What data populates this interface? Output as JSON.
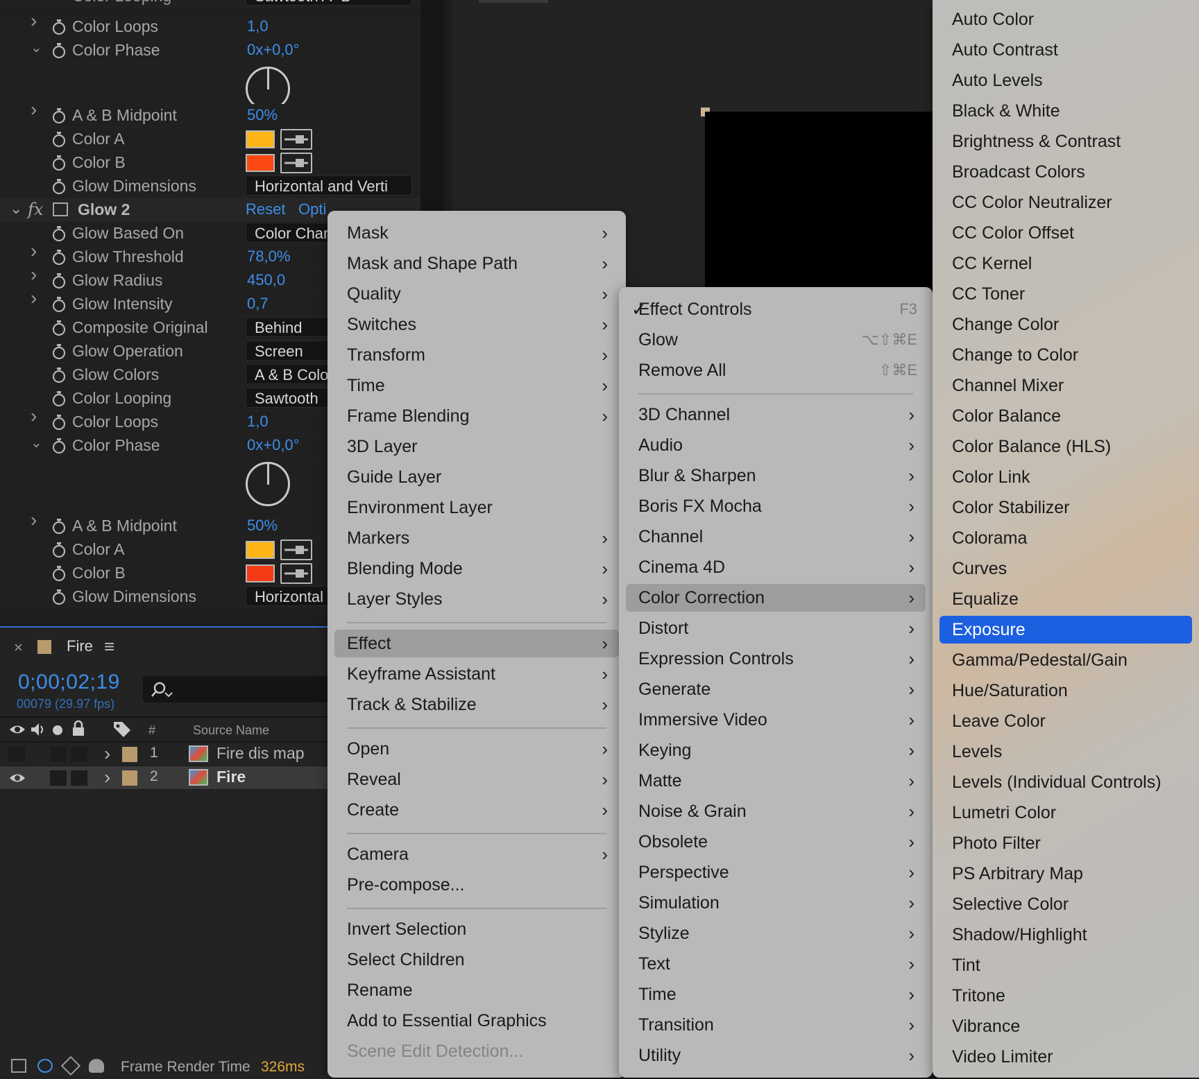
{
  "effect_controls": {
    "top_clip_row": {
      "label": "Color Looping",
      "value": "Sawtooth A>B"
    },
    "rows_a": [
      {
        "type": "num",
        "twirl": "right",
        "label": "Color Loops",
        "value": "1,0"
      },
      {
        "type": "num",
        "twirl": "down",
        "label": "Color Phase",
        "value": "0x+0,0°"
      }
    ],
    "rows_b": [
      {
        "type": "num",
        "twirl": "right",
        "label": "A & B Midpoint",
        "value": "50%"
      },
      {
        "type": "color",
        "label": "Color A",
        "color": "#fdb515"
      },
      {
        "type": "color",
        "label": "Color B",
        "color": "#fb4a12"
      },
      {
        "type": "dd",
        "label": "Glow Dimensions",
        "value": "Horizontal and Verti"
      }
    ],
    "glow2": {
      "name": "Glow 2",
      "reset": "Reset",
      "options": "Opti",
      "fx": "fx"
    },
    "rows_c": [
      {
        "type": "dd",
        "label": "Glow Based On",
        "value": "Color Chan"
      },
      {
        "type": "num",
        "twirl": "right",
        "label": "Glow Threshold",
        "value": "78,0%"
      },
      {
        "type": "num",
        "twirl": "right",
        "label": "Glow Radius",
        "value": "450,0"
      },
      {
        "type": "num",
        "twirl": "right",
        "label": "Glow Intensity",
        "value": "0,7"
      },
      {
        "type": "dd",
        "label": "Composite Original",
        "value": "Behind"
      },
      {
        "type": "dd",
        "label": "Glow Operation",
        "value": "Screen"
      },
      {
        "type": "dd",
        "label": "Glow Colors",
        "value": "A & B Colo"
      },
      {
        "type": "dd",
        "label": "Color Looping",
        "value": "Sawtooth"
      },
      {
        "type": "num",
        "twirl": "right",
        "label": "Color Loops",
        "value": "1,0"
      },
      {
        "type": "num",
        "twirl": "down",
        "label": "Color Phase",
        "value": "0x+0,0°"
      }
    ],
    "rows_d": [
      {
        "type": "num",
        "twirl": "right",
        "label": "A & B Midpoint",
        "value": "50%"
      },
      {
        "type": "color",
        "label": "Color A",
        "color": "#fdb515"
      },
      {
        "type": "color",
        "label": "Color B",
        "color": "#f53a16"
      },
      {
        "type": "dd",
        "label": "Glow Dimensions",
        "value": "Horizontal"
      }
    ]
  },
  "timeline": {
    "close": "×",
    "comp_name": "Fire",
    "menu_icon": "≡",
    "timecode": "0;00;02;19",
    "frames": "00079 (29.97 fps)",
    "col_number": "#",
    "col_source": "Source Name",
    "layers": [
      {
        "num": "1",
        "name": "Fire dis map",
        "visible": false
      },
      {
        "num": "2",
        "name": "Fire",
        "visible": true
      }
    ],
    "footer_label": "Frame Render Time",
    "footer_value": "326ms"
  },
  "menu1": {
    "items": [
      {
        "label": "Mask",
        "sub": true
      },
      {
        "label": "Mask and Shape Path",
        "sub": true
      },
      {
        "label": "Quality",
        "sub": true
      },
      {
        "label": "Switches",
        "sub": true
      },
      {
        "label": "Transform",
        "sub": true
      },
      {
        "label": "Time",
        "sub": true
      },
      {
        "label": "Frame Blending",
        "sub": true
      },
      {
        "label": "3D Layer",
        "sub": false
      },
      {
        "label": "Guide Layer",
        "sub": false
      },
      {
        "label": "Environment Layer",
        "sub": false
      },
      {
        "label": "Markers",
        "sub": true
      },
      {
        "label": "Blending Mode",
        "sub": true
      },
      {
        "label": "Layer Styles",
        "sub": true
      },
      {
        "sep": true
      },
      {
        "label": "Effect",
        "sub": true,
        "selected": true
      },
      {
        "label": "Keyframe Assistant",
        "sub": true
      },
      {
        "label": "Track & Stabilize",
        "sub": true
      },
      {
        "sep": true
      },
      {
        "label": "Open",
        "sub": true
      },
      {
        "label": "Reveal",
        "sub": true
      },
      {
        "label": "Create",
        "sub": true
      },
      {
        "sep": true
      },
      {
        "label": "Camera",
        "sub": true
      },
      {
        "label": "Pre-compose...",
        "sub": false
      },
      {
        "sep": true
      },
      {
        "label": "Invert Selection",
        "sub": false
      },
      {
        "label": "Select Children",
        "sub": false
      },
      {
        "label": "Rename",
        "sub": false
      },
      {
        "label": "Add to Essential Graphics",
        "sub": false
      },
      {
        "label": "Scene Edit Detection...",
        "sub": false,
        "disabled": true
      }
    ]
  },
  "menu2": {
    "items": [
      {
        "label": "Effect Controls",
        "check": "✓",
        "shortcut": "F3"
      },
      {
        "label": "Glow",
        "shortcut": "⌥⇧⌘E"
      },
      {
        "label": "Remove All",
        "shortcut": "⇧⌘E"
      },
      {
        "sep": true
      },
      {
        "label": "3D Channel",
        "sub": true
      },
      {
        "label": "Audio",
        "sub": true
      },
      {
        "label": "Blur & Sharpen",
        "sub": true
      },
      {
        "label": "Boris FX Mocha",
        "sub": true
      },
      {
        "label": "Channel",
        "sub": true
      },
      {
        "label": "Cinema 4D",
        "sub": true
      },
      {
        "label": "Color Correction",
        "sub": true,
        "selected": true
      },
      {
        "label": "Distort",
        "sub": true
      },
      {
        "label": "Expression Controls",
        "sub": true
      },
      {
        "label": "Generate",
        "sub": true
      },
      {
        "label": "Immersive Video",
        "sub": true
      },
      {
        "label": "Keying",
        "sub": true
      },
      {
        "label": "Matte",
        "sub": true
      },
      {
        "label": "Noise & Grain",
        "sub": true
      },
      {
        "label": "Obsolete",
        "sub": true
      },
      {
        "label": "Perspective",
        "sub": true
      },
      {
        "label": "Simulation",
        "sub": true
      },
      {
        "label": "Stylize",
        "sub": true
      },
      {
        "label": "Text",
        "sub": true
      },
      {
        "label": "Time",
        "sub": true
      },
      {
        "label": "Transition",
        "sub": true
      },
      {
        "label": "Utility",
        "sub": true
      }
    ]
  },
  "menu3": {
    "highlight": "#1c5fe0",
    "items": [
      "Auto Color",
      "Auto Contrast",
      "Auto Levels",
      "Black & White",
      "Brightness & Contrast",
      "Broadcast Colors",
      "CC Color Neutralizer",
      "CC Color Offset",
      "CC Kernel",
      "CC Toner",
      "Change Color",
      "Change to Color",
      "Channel Mixer",
      "Color Balance",
      "Color Balance (HLS)",
      "Color Link",
      "Color Stabilizer",
      "Colorama",
      "Curves",
      "Equalize",
      "Exposure",
      "Gamma/Pedestal/Gain",
      "Hue/Saturation",
      "Leave Color",
      "Levels",
      "Levels (Individual Controls)",
      "Lumetri Color",
      "Photo Filter",
      "PS Arbitrary Map",
      "Selective Color",
      "Shadow/Highlight",
      "Tint",
      "Tritone",
      "Vibrance",
      "Video Limiter"
    ],
    "active": "Exposure"
  }
}
